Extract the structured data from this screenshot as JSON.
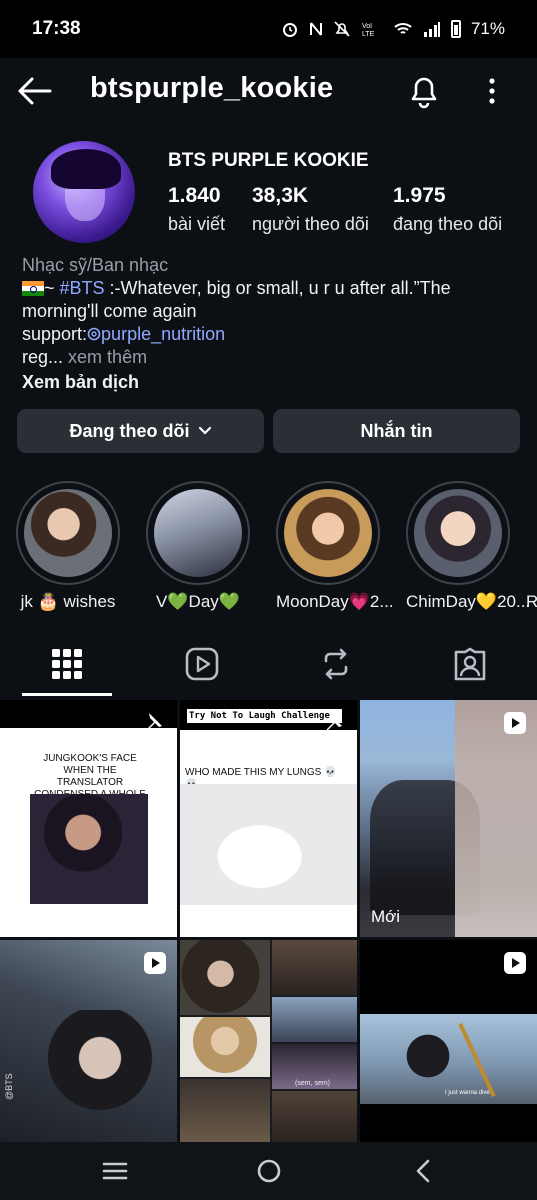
{
  "status_bar": {
    "time": "17:38",
    "battery": "71%"
  },
  "header": {
    "username": "btspurple_kookie"
  },
  "profile": {
    "display_name": "BTS PURPLE KOOKIE",
    "stats": [
      {
        "value": "1.840",
        "label": "bài viết"
      },
      {
        "value": "38,3K",
        "label": "người theo dõi"
      },
      {
        "value": "1.975",
        "label": "đang theo dõi"
      }
    ],
    "bio": {
      "category": "Nhạc sỹ/Ban nhạc",
      "line1_prefix": "~ ",
      "hashtag": "#BTS",
      "line1_rest": " :-Whatever, big or small, u r u after all.”The",
      "line2": "morning'll come again",
      "support_prefix": "support:",
      "mention": "purple_nutrition",
      "line4": "reg...",
      "see_more": "xem thêm",
      "translate": "Xem bản dịch"
    }
  },
  "actions": {
    "following": "Đang theo dõi",
    "message": "Nhắn tin"
  },
  "highlights": [
    {
      "label": "jk 🎂 wishes"
    },
    {
      "label": "V💚Day💚"
    },
    {
      "label": "MoonDay💗2..."
    },
    {
      "label": "ChimDay💛20..."
    },
    {
      "label": "R"
    }
  ],
  "grid": {
    "post1_caption": "JUNGKOOK'S FACE WHEN THE TRANSLATOR CONDENSED A WHOLE PARAGRAPH INTO TWO WORDS SENDS",
    "post2_header": "Try Not To Laugh Challenge",
    "post2_caption": "WHO MADE THIS MY LUNGS 💀💀",
    "post3_label": "Mới",
    "post4_watermark": "@BTS",
    "post5_subtitle": "(sem, sem)",
    "post6_subtitle": "I just wanna dive"
  },
  "colors": {
    "background": "#0c0f14",
    "button": "#2a2f36",
    "link": "#8fa9ff",
    "muted": "#9a9ea5"
  }
}
